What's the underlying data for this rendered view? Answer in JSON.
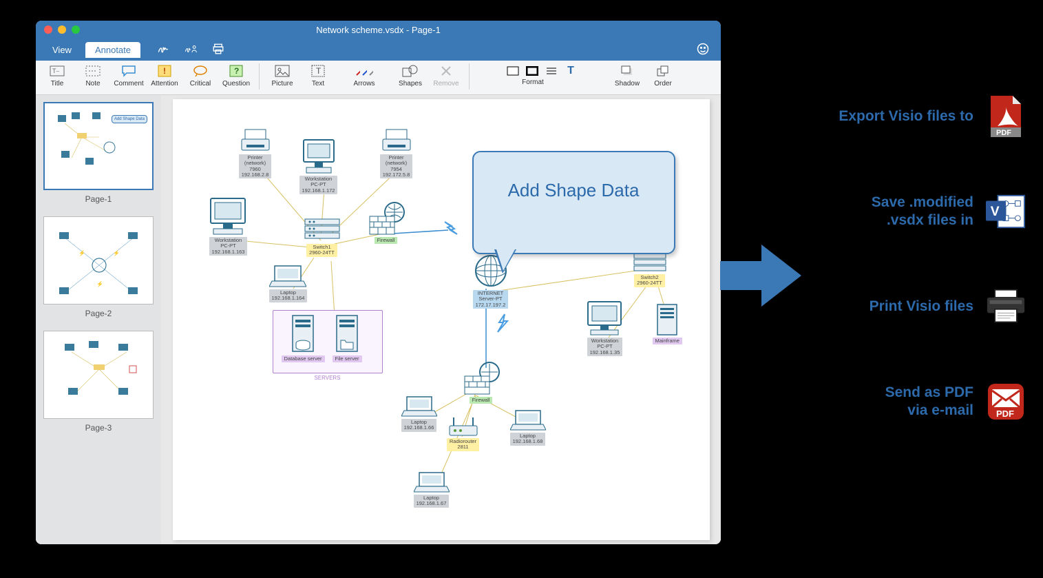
{
  "window_title": "Network scheme.vsdx - Page-1",
  "tabs": {
    "view": "View",
    "annotate": "Annotate"
  },
  "toolbar": {
    "title": "Title",
    "note": "Note",
    "comment": "Comment",
    "attention": "Attention",
    "critical": "Critical",
    "question": "Question",
    "picture": "Picture",
    "text": "Text",
    "arrows": "Arrows",
    "shapes": "Shapes",
    "remove": "Remove",
    "format": "Format",
    "shadow": "Shadow",
    "order": "Order"
  },
  "pages": [
    "Page-1",
    "Page-2",
    "Page-3"
  ],
  "callout_text": "Add Shape Data",
  "diagram": {
    "printer1": "Printer\n(network)\n7960\n192.168.2.8",
    "printer2": "Printer\n(network)\n7954\n192.172.5.8",
    "ws1": "Workstation\nPC-PT\n192.168.1.172",
    "ws2": "Workstation\nPC-PT\n192.168.1.163",
    "ws3": "Workstation\nPC-PT\n192.168.1.35",
    "switch1": "Switch1\n2960-24TT",
    "switch2": "Switch2\n2960-24TT",
    "firewall": "Firewall",
    "laptop1": "Laptop\n192.168.1.164",
    "laptop2": "Laptop\n192.168.1.66",
    "laptop3": "Laptop\n192.168.1.68",
    "laptop4": "Laptop\n192.168.1.67",
    "internet": "INTERNET\nServer-PT\n172.17.197.2",
    "radiorouter": "Radiorouter\n2811",
    "dbserver": "Database server",
    "fileserver": "File server",
    "mainframe": "Mainframe",
    "group_servers": "SERVERS"
  },
  "promo": {
    "export": "Export Visio files to",
    "save": "Save .modified\n.vsdx files in",
    "print": "Print Visio files",
    "send": "Send as PDF\nvia e-mail"
  }
}
